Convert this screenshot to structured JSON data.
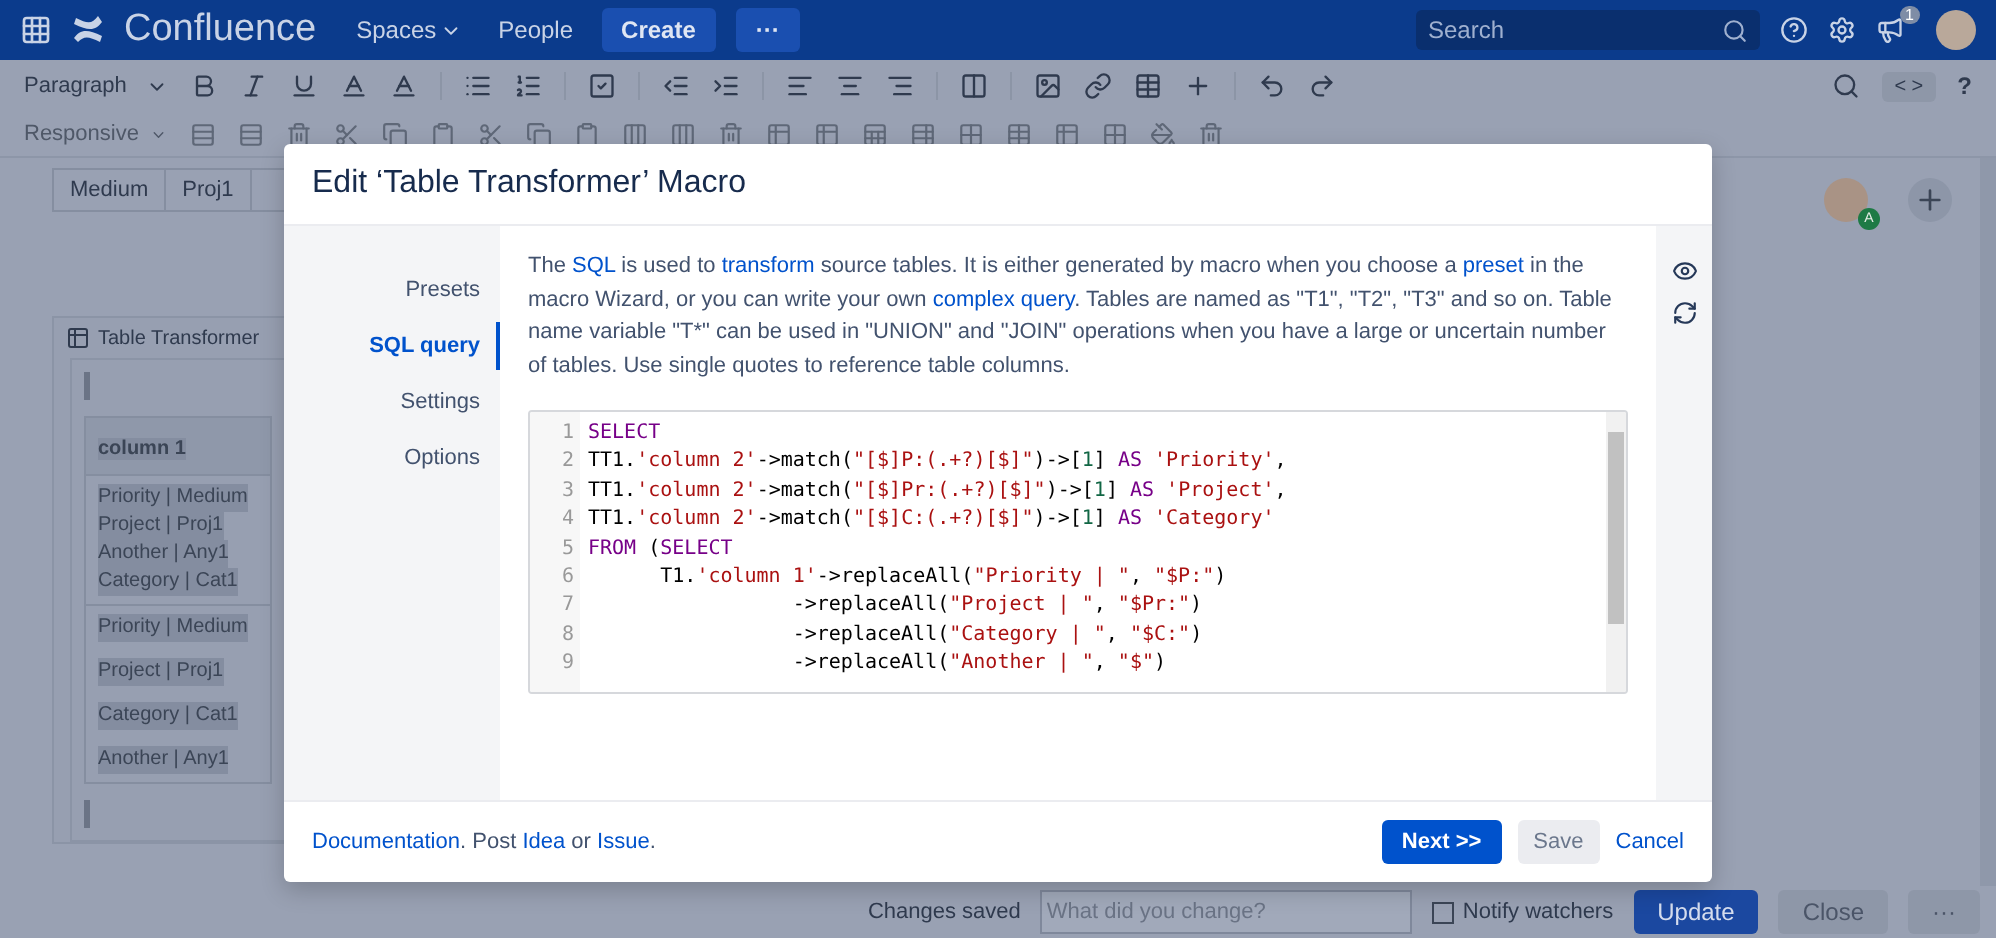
{
  "top_nav": {
    "product": "Confluence",
    "links": [
      {
        "label": "Spaces",
        "dropdown": true
      },
      {
        "label": "People",
        "dropdown": false
      }
    ],
    "create": "Create",
    "more": "···",
    "search": {
      "placeholder": "Search"
    },
    "notifications": "1"
  },
  "toolbar": {
    "style": "Paragraph",
    "layout": "Responsive",
    "code_toggle": "< >",
    "help": "?"
  },
  "page": {
    "table_row": [
      "Medium",
      "Proj1"
    ],
    "macro": {
      "title": "Table Transformer",
      "header": "column 1",
      "cells": [
        [
          "Priority | Medium",
          "Project | Proj1",
          "Another | Any1",
          "Category | Cat1"
        ],
        [
          "Priority | Medium",
          "Project | Proj1",
          "Category | Cat1",
          "Another | Any1"
        ]
      ]
    },
    "avatar_badge": "A"
  },
  "bottom_bar": {
    "status": "Changes saved",
    "comment": {
      "placeholder": "What did you change?"
    },
    "notify": {
      "label": "Notify watchers",
      "checked": false
    },
    "update": "Update",
    "close": "Close",
    "more": "···"
  },
  "dialog": {
    "title": "Edit ‘Table Transformer’ Macro",
    "nav": [
      {
        "label": "Presets",
        "selected": false
      },
      {
        "label": "SQL query",
        "selected": true
      },
      {
        "label": "Settings",
        "selected": false
      },
      {
        "label": "Options",
        "selected": false
      }
    ],
    "description": [
      {
        "text": "The ",
        "link": false
      },
      {
        "text": "SQL",
        "link": true
      },
      {
        "text": " is used to ",
        "link": false
      },
      {
        "text": "transform",
        "link": true
      },
      {
        "text": " source tables. It is either generated by macro when you choose a ",
        "link": false
      },
      {
        "text": "preset",
        "link": true
      },
      {
        "text": " in the macro Wizard, or you can write your own ",
        "link": false
      },
      {
        "text": "complex query",
        "link": true
      },
      {
        "text": ". Tables are named as \"T1\", \"T2\", \"T3\" and so on. Table name variable \"T*\" can be used in \"UNION\" and \"JOIN\" operations when you have a large or uncertain number of tables. Use single quotes to reference table columns.",
        "link": false
      }
    ],
    "code": [
      {
        "number": "1",
        "tokens": [
          {
            "kind": "keyword",
            "text": "SELECT"
          }
        ]
      },
      {
        "number": "2",
        "tokens": [
          {
            "kind": "plain",
            "text": "TT1."
          },
          {
            "kind": "string",
            "text": "'column 2'"
          },
          {
            "kind": "plain",
            "text": "->match("
          },
          {
            "kind": "string",
            "text": "\"[$]P:(.+?)[$]\""
          },
          {
            "kind": "plain",
            "text": ")->["
          },
          {
            "kind": "number",
            "text": "1"
          },
          {
            "kind": "plain",
            "text": "] "
          },
          {
            "kind": "keyword",
            "text": "AS"
          },
          {
            "kind": "string",
            "text": " 'Priority'"
          },
          {
            "kind": "plain",
            "text": ","
          }
        ]
      },
      {
        "number": "3",
        "tokens": [
          {
            "kind": "plain",
            "text": "TT1."
          },
          {
            "kind": "string",
            "text": "'column 2'"
          },
          {
            "kind": "plain",
            "text": "->match("
          },
          {
            "kind": "string",
            "text": "\"[$]Pr:(.+?)[$]\""
          },
          {
            "kind": "plain",
            "text": ")->["
          },
          {
            "kind": "number",
            "text": "1"
          },
          {
            "kind": "plain",
            "text": "] "
          },
          {
            "kind": "keyword",
            "text": "AS"
          },
          {
            "kind": "string",
            "text": " 'Project'"
          },
          {
            "kind": "plain",
            "text": ","
          }
        ]
      },
      {
        "number": "4",
        "tokens": [
          {
            "kind": "plain",
            "text": "TT1."
          },
          {
            "kind": "string",
            "text": "'column 2'"
          },
          {
            "kind": "plain",
            "text": "->match("
          },
          {
            "kind": "string",
            "text": "\"[$]C:(.+?)[$]\""
          },
          {
            "kind": "plain",
            "text": ")->["
          },
          {
            "kind": "number",
            "text": "1"
          },
          {
            "kind": "plain",
            "text": "] "
          },
          {
            "kind": "keyword",
            "text": "AS"
          },
          {
            "kind": "string",
            "text": " 'Category'"
          }
        ]
      },
      {
        "number": "5",
        "tokens": [
          {
            "kind": "keyword",
            "text": "FROM"
          },
          {
            "kind": "plain",
            "text": " ("
          },
          {
            "kind": "keyword",
            "text": "SELECT"
          }
        ]
      },
      {
        "number": "6",
        "tokens": [
          {
            "kind": "plain",
            "text": "      T1."
          },
          {
            "kind": "string",
            "text": "'column 1'"
          },
          {
            "kind": "plain",
            "text": "->replaceAll("
          },
          {
            "kind": "string",
            "text": "\"Priority | \""
          },
          {
            "kind": "plain",
            "text": ", "
          },
          {
            "kind": "string",
            "text": "\"$P:\""
          },
          {
            "kind": "plain",
            "text": ")"
          }
        ]
      },
      {
        "number": "7",
        "tokens": [
          {
            "kind": "plain",
            "text": "                 ->replaceAll("
          },
          {
            "kind": "string",
            "text": "\"Project | \""
          },
          {
            "kind": "plain",
            "text": ", "
          },
          {
            "kind": "string",
            "text": "\"$Pr:\""
          },
          {
            "kind": "plain",
            "text": ")"
          }
        ]
      },
      {
        "number": "8",
        "tokens": [
          {
            "kind": "plain",
            "text": "                 ->replaceAll("
          },
          {
            "kind": "string",
            "text": "\"Category | \""
          },
          {
            "kind": "plain",
            "text": ", "
          },
          {
            "kind": "string",
            "text": "\"$C:\""
          },
          {
            "kind": "plain",
            "text": ")"
          }
        ]
      },
      {
        "number": "9",
        "tokens": [
          {
            "kind": "plain",
            "text": "                 ->replaceAll("
          },
          {
            "kind": "string",
            "text": "\"Another | \""
          },
          {
            "kind": "plain",
            "text": ", "
          },
          {
            "kind": "string",
            "text": "\"$\""
          },
          {
            "kind": "plain",
            "text": ")"
          }
        ]
      }
    ],
    "footer": [
      {
        "text": "Documentation",
        "link": true
      },
      {
        "text": ". Post ",
        "link": false
      },
      {
        "text": "Idea",
        "link": true
      },
      {
        "text": " or ",
        "link": false
      },
      {
        "text": "Issue",
        "link": true
      },
      {
        "text": ".",
        "link": false
      }
    ],
    "buttons": {
      "next": "Next >>",
      "save": "Save",
      "cancel": "Cancel"
    }
  }
}
